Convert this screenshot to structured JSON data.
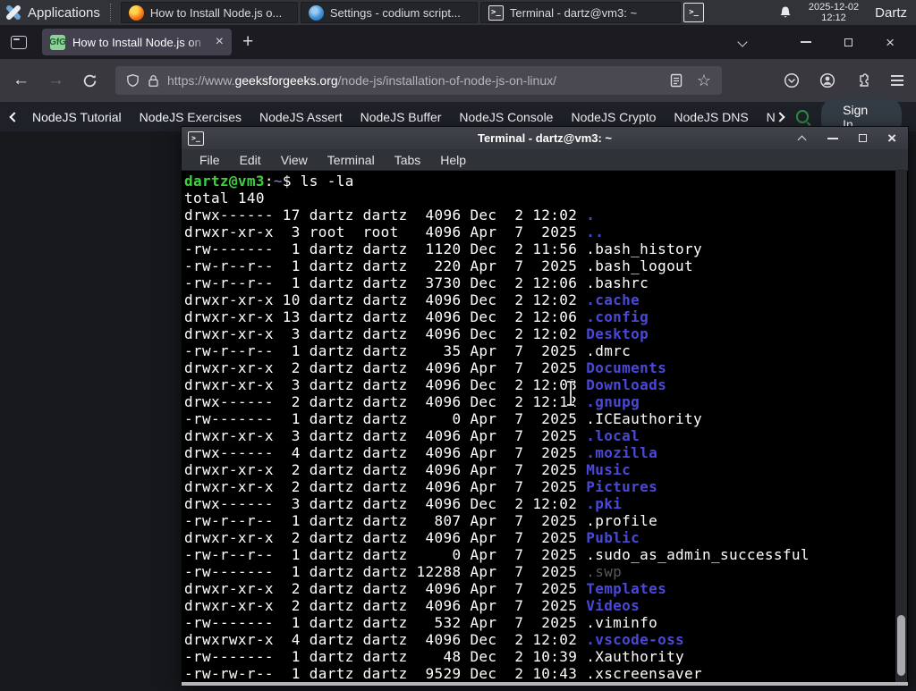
{
  "colors": {
    "panel_bg": "#313338",
    "accent_green": "#2f8d46",
    "dir_blue": "#4a49d7",
    "prompt_green": "#3ed13e",
    "terminal_bg": "#000000",
    "tab_bg": "#42414d",
    "toolbar_bg": "#39383f"
  },
  "panel": {
    "applications_label": "Applications",
    "windows": [
      {
        "app": "firefox",
        "label": "How to Install Node.js o..."
      },
      {
        "app": "codium",
        "label": "Settings - codium script..."
      },
      {
        "app": "terminal",
        "label": "Terminal - dartz@vm3: ~"
      }
    ],
    "clock_date": "2025-12-02",
    "clock_time": "12:12",
    "user": "Dartz"
  },
  "browser": {
    "tab": {
      "title": "How to Install Node.js on",
      "close": "×"
    },
    "new_tab": "+",
    "window_close": "×",
    "urlbar": {
      "prefix": "https://www.",
      "domain": "geeksforgeeks.org",
      "path": "/node-js/installation-of-node-js-on-linux/"
    },
    "star": "☆"
  },
  "site_nav": {
    "items": [
      "NodeJS Tutorial",
      "NodeJS Exercises",
      "NodeJS Assert",
      "NodeJS Buffer",
      "NodeJS Console",
      "NodeJS Crypto",
      "NodeJS DNS",
      "Node"
    ],
    "sign_in": "Sign In"
  },
  "terminal": {
    "title": "Terminal - dartz@vm3: ~",
    "menus": [
      "File",
      "Edit",
      "View",
      "Terminal",
      "Tabs",
      "Help"
    ],
    "lines": [
      {
        "seg": [
          {
            "t": "dartz@vm3",
            "c": "g"
          },
          {
            "t": ":",
            "c": "w"
          },
          {
            "t": "~",
            "c": "t"
          },
          {
            "t": "$ ls -la",
            "c": "w"
          }
        ]
      },
      {
        "seg": [
          {
            "t": "total 140",
            "c": "w"
          }
        ]
      },
      {
        "seg": [
          {
            "t": "drwx------ 17 dartz dartz  4096 Dec  2 12:02 ",
            "c": "w"
          },
          {
            "t": ".",
            "c": "b"
          }
        ]
      },
      {
        "seg": [
          {
            "t": "drwxr-xr-x  3 root  root   4096 Apr  7  2025 ",
            "c": "w"
          },
          {
            "t": "..",
            "c": "b"
          }
        ]
      },
      {
        "seg": [
          {
            "t": "-rw-------  1 dartz dartz  1120 Dec  2 11:56 ",
            "c": "w"
          },
          {
            "t": ".bash_history",
            "c": "w"
          }
        ]
      },
      {
        "seg": [
          {
            "t": "-rw-r--r--  1 dartz dartz   220 Apr  7  2025 ",
            "c": "w"
          },
          {
            "t": ".bash_logout",
            "c": "w"
          }
        ]
      },
      {
        "seg": [
          {
            "t": "-rw-r--r--  1 dartz dartz  3730 Dec  2 12:06 ",
            "c": "w"
          },
          {
            "t": ".bashrc",
            "c": "w"
          }
        ]
      },
      {
        "seg": [
          {
            "t": "drwxr-xr-x 10 dartz dartz  4096 Dec  2 12:02 ",
            "c": "w"
          },
          {
            "t": ".cache",
            "c": "b"
          }
        ]
      },
      {
        "seg": [
          {
            "t": "drwxr-xr-x 13 dartz dartz  4096 Dec  2 12:06 ",
            "c": "w"
          },
          {
            "t": ".config",
            "c": "b"
          }
        ]
      },
      {
        "seg": [
          {
            "t": "drwxr-xr-x  3 dartz dartz  4096 Dec  2 12:02 ",
            "c": "w"
          },
          {
            "t": "Desktop",
            "c": "b"
          }
        ]
      },
      {
        "seg": [
          {
            "t": "-rw-r--r--  1 dartz dartz    35 Apr  7  2025 ",
            "c": "w"
          },
          {
            "t": ".dmrc",
            "c": "w"
          }
        ]
      },
      {
        "seg": [
          {
            "t": "drwxr-xr-x  2 dartz dartz  4096 Apr  7  2025 ",
            "c": "w"
          },
          {
            "t": "Documents",
            "c": "b"
          }
        ]
      },
      {
        "seg": [
          {
            "t": "drwxr-xr-x  3 dartz dartz  4096 Dec  2 12:03 ",
            "c": "w"
          },
          {
            "t": "Downloads",
            "c": "b"
          }
        ]
      },
      {
        "seg": [
          {
            "t": "drwx------  2 dartz dartz  4096 Dec  2 12:12 ",
            "c": "w"
          },
          {
            "t": ".gnupg",
            "c": "b"
          }
        ]
      },
      {
        "seg": [
          {
            "t": "-rw-------  1 dartz dartz     0 Apr  7  2025 ",
            "c": "w"
          },
          {
            "t": ".ICEauthority",
            "c": "w"
          }
        ]
      },
      {
        "seg": [
          {
            "t": "drwxr-xr-x  3 dartz dartz  4096 Apr  7  2025 ",
            "c": "w"
          },
          {
            "t": ".local",
            "c": "b"
          }
        ]
      },
      {
        "seg": [
          {
            "t": "drwx------  4 dartz dartz  4096 Apr  7  2025 ",
            "c": "w"
          },
          {
            "t": ".mozilla",
            "c": "b"
          }
        ]
      },
      {
        "seg": [
          {
            "t": "drwxr-xr-x  2 dartz dartz  4096 Apr  7  2025 ",
            "c": "w"
          },
          {
            "t": "Music",
            "c": "b"
          }
        ]
      },
      {
        "seg": [
          {
            "t": "drwxr-xr-x  2 dartz dartz  4096 Apr  7  2025 ",
            "c": "w"
          },
          {
            "t": "Pictures",
            "c": "b"
          }
        ]
      },
      {
        "seg": [
          {
            "t": "drwx------  3 dartz dartz  4096 Dec  2 12:02 ",
            "c": "w"
          },
          {
            "t": ".pki",
            "c": "b"
          }
        ]
      },
      {
        "seg": [
          {
            "t": "-rw-r--r--  1 dartz dartz   807 Apr  7  2025 ",
            "c": "w"
          },
          {
            "t": ".profile",
            "c": "w"
          }
        ]
      },
      {
        "seg": [
          {
            "t": "drwxr-xr-x  2 dartz dartz  4096 Apr  7  2025 ",
            "c": "w"
          },
          {
            "t": "Public",
            "c": "b"
          }
        ]
      },
      {
        "seg": [
          {
            "t": "-rw-r--r--  1 dartz dartz     0 Apr  7  2025 ",
            "c": "w"
          },
          {
            "t": ".sudo_as_admin_successful",
            "c": "w"
          }
        ]
      },
      {
        "seg": [
          {
            "t": "-rw-------  1 dartz dartz 12288 Apr  7  2025 ",
            "c": "w"
          },
          {
            "t": ".swp",
            "c": "d"
          }
        ]
      },
      {
        "seg": [
          {
            "t": "drwxr-xr-x  2 dartz dartz  4096 Apr  7  2025 ",
            "c": "w"
          },
          {
            "t": "Templates",
            "c": "b"
          }
        ]
      },
      {
        "seg": [
          {
            "t": "drwxr-xr-x  2 dartz dartz  4096 Apr  7  2025 ",
            "c": "w"
          },
          {
            "t": "Videos",
            "c": "b"
          }
        ]
      },
      {
        "seg": [
          {
            "t": "-rw-------  1 dartz dartz   532 Apr  7  2025 ",
            "c": "w"
          },
          {
            "t": ".viminfo",
            "c": "w"
          }
        ]
      },
      {
        "seg": [
          {
            "t": "drwxrwxr-x  4 dartz dartz  4096 Dec  2 12:02 ",
            "c": "w"
          },
          {
            "t": ".vscode-oss",
            "c": "b"
          }
        ]
      },
      {
        "seg": [
          {
            "t": "-rw-------  1 dartz dartz    48 Dec  2 10:39 ",
            "c": "w"
          },
          {
            "t": ".Xauthority",
            "c": "w"
          }
        ]
      },
      {
        "seg": [
          {
            "t": "-rw-rw-r--  1 dartz dartz  9529 Dec  2 10:43 ",
            "c": "w"
          },
          {
            "t": ".xscreensaver",
            "c": "w"
          }
        ]
      }
    ]
  }
}
